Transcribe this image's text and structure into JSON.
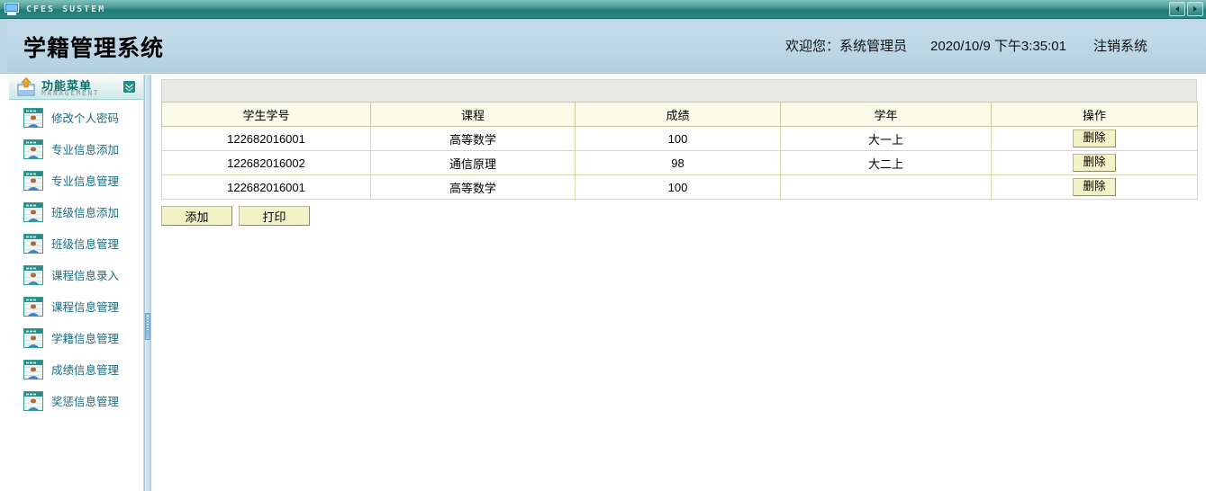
{
  "window": {
    "title": "CFES SUSTEM",
    "icon": "monitor-icon",
    "nav_prev_label": "◀",
    "nav_next_label": "▶"
  },
  "header": {
    "app_title": "学籍管理系统",
    "welcome": "欢迎您：系统管理员",
    "datetime": "2020/10/9 下午3:35:01",
    "logout": "注销系统"
  },
  "sidebar": {
    "panel_title": "功能菜单",
    "panel_subtitle": "MANAGEMENT",
    "collapse_icon": "chevron-double-down-icon",
    "items": [
      {
        "label": "修改个人密码"
      },
      {
        "label": "专业信息添加"
      },
      {
        "label": "专业信息管理"
      },
      {
        "label": "班级信息添加"
      },
      {
        "label": "班级信息管理"
      },
      {
        "label": "课程信息录入"
      },
      {
        "label": "课程信息管理"
      },
      {
        "label": "学籍信息管理"
      },
      {
        "label": "成绩信息管理"
      },
      {
        "label": "奖惩信息管理"
      }
    ]
  },
  "main": {
    "table": {
      "headers": [
        "学生学号",
        "课程",
        "成绩",
        "学年",
        "操作"
      ],
      "rows": [
        {
          "id": "122682016001",
          "course": "高等数学",
          "score": "100",
          "year": "大一上",
          "action": "删除"
        },
        {
          "id": "122682016002",
          "course": "通信原理",
          "score": "98",
          "year": "大二上",
          "action": "删除"
        },
        {
          "id": "122682016001",
          "course": "高等数学",
          "score": "100",
          "year": "",
          "action": "删除"
        }
      ]
    },
    "buttons": {
      "add": "添加",
      "print": "打印"
    }
  },
  "colors": {
    "titlebar": "#2d8883",
    "header_bg": "#bcd7e6",
    "grid_header_bg": "#fbfbe9",
    "button_bg": "#f2f2c6",
    "menu_text": "#1a6b80",
    "menu_title": "#0b6f69"
  }
}
